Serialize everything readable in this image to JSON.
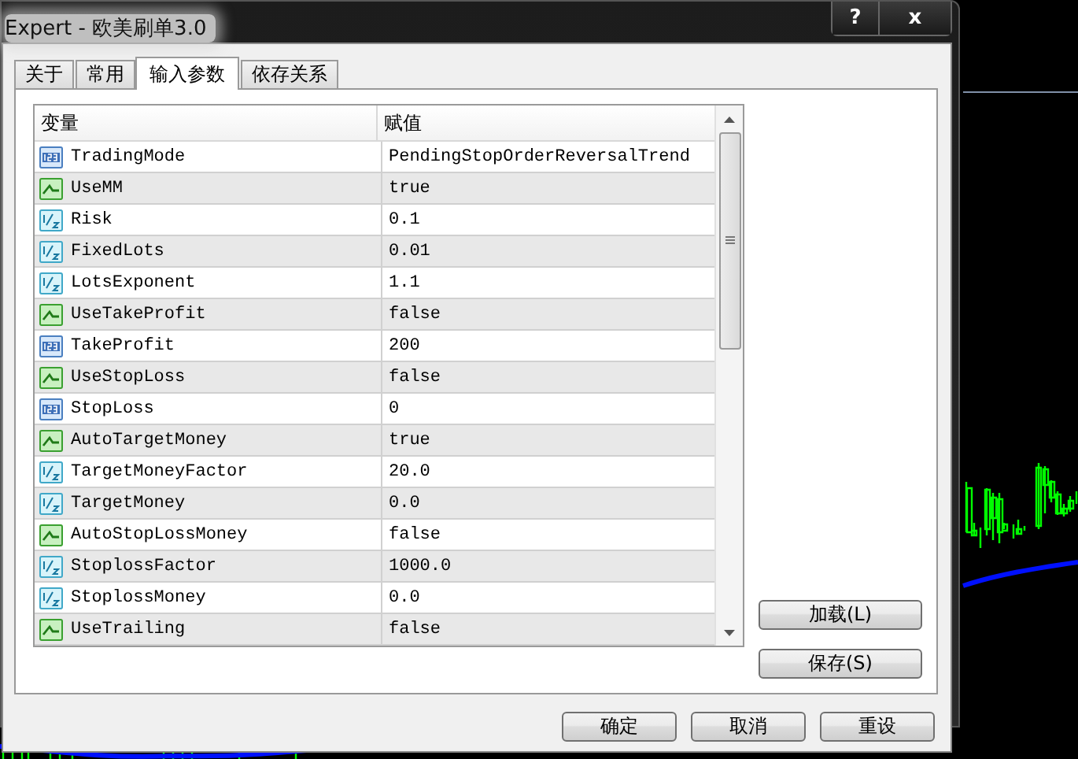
{
  "window": {
    "title": "Expert - 欧美刷单3.0",
    "help_button": "?",
    "close_button": "x"
  },
  "tabs": [
    {
      "label": "关于",
      "selected": false
    },
    {
      "label": "常用",
      "selected": false
    },
    {
      "label": "输入参数",
      "selected": true
    },
    {
      "label": "依存关系",
      "selected": false
    }
  ],
  "table": {
    "columns": [
      "变量",
      "赋值"
    ],
    "rows": [
      {
        "kind": "int",
        "name": "TradingMode",
        "value": "PendingStopOrderReversalTrend"
      },
      {
        "kind": "bool",
        "name": "UseMM",
        "value": "true"
      },
      {
        "kind": "double",
        "name": "Risk",
        "value": "0.1"
      },
      {
        "kind": "double",
        "name": "FixedLots",
        "value": "0.01"
      },
      {
        "kind": "double",
        "name": "LotsExponent",
        "value": "1.1"
      },
      {
        "kind": "bool",
        "name": "UseTakeProfit",
        "value": "false"
      },
      {
        "kind": "int",
        "name": "TakeProfit",
        "value": "200"
      },
      {
        "kind": "bool",
        "name": "UseStopLoss",
        "value": "false"
      },
      {
        "kind": "int",
        "name": "StopLoss",
        "value": "0"
      },
      {
        "kind": "bool",
        "name": "AutoTargetMoney",
        "value": "true"
      },
      {
        "kind": "double",
        "name": "TargetMoneyFactor",
        "value": "20.0"
      },
      {
        "kind": "double",
        "name": "TargetMoney",
        "value": "0.0"
      },
      {
        "kind": "bool",
        "name": "AutoStopLossMoney",
        "value": "false"
      },
      {
        "kind": "double",
        "name": "StoplossFactor",
        "value": "1000.0"
      },
      {
        "kind": "double",
        "name": "StoplossMoney",
        "value": "0.0"
      },
      {
        "kind": "bool",
        "name": "UseTrailing",
        "value": "false"
      }
    ]
  },
  "side_buttons": [
    "加载(L)",
    "保存(S)"
  ],
  "buttons": [
    "确定",
    "取消",
    "重设"
  ]
}
